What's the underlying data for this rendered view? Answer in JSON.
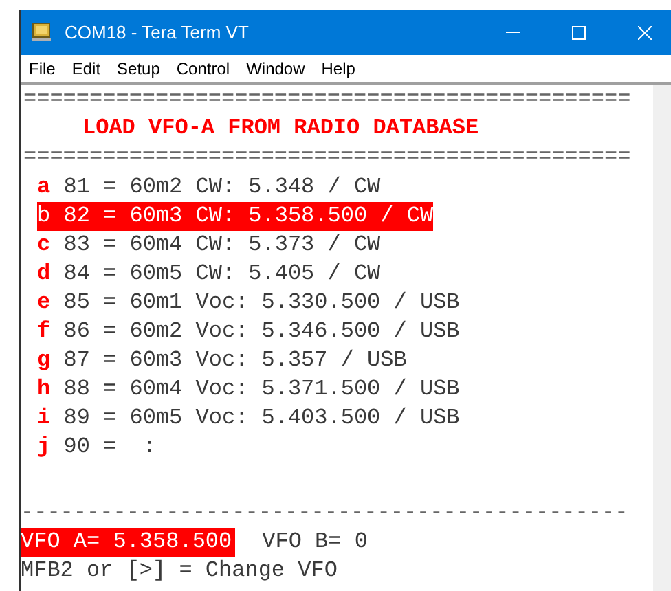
{
  "window": {
    "title": "COM18 - Tera Term VT"
  },
  "menu": [
    "File",
    "Edit",
    "Setup",
    "Control",
    "Window",
    "Help"
  ],
  "terminal": {
    "separator_top": "==============================================",
    "heading": "LOAD VFO-A FROM RADIO DATABASE",
    "separator_bottom": "==============================================",
    "entries": [
      {
        "key": "a",
        "text": "81 = 60m2 CW: 5.348 / CW",
        "selected": false
      },
      {
        "key": "b",
        "text": "82 = 60m3 CW: 5.358.500 / CW",
        "selected": true
      },
      {
        "key": "c",
        "text": "83 = 60m4 CW: 5.373 / CW",
        "selected": false
      },
      {
        "key": "d",
        "text": "84 = 60m5 CW: 5.405 / CW",
        "selected": false
      },
      {
        "key": "e",
        "text": "85 = 60m1 Voc: 5.330.500 / USB",
        "selected": false
      },
      {
        "key": "f",
        "text": "86 = 60m2 Voc: 5.346.500 / USB",
        "selected": false
      },
      {
        "key": "g",
        "text": "87 = 60m3 Voc: 5.357 / USB",
        "selected": false
      },
      {
        "key": "h",
        "text": "88 = 60m4 Voc: 5.371.500 / USB",
        "selected": false
      },
      {
        "key": "i",
        "text": "89 = 60m5 Voc: 5.403.500 / USB",
        "selected": false
      },
      {
        "key": "j",
        "text": "90 =  :",
        "selected": false
      }
    ],
    "divider": "----------------------------------------------",
    "vfo_a": "VFO A= 5.358.500",
    "vfo_b": "VFO B= 0",
    "hint": "MFB2 or [>] = Change VFO"
  }
}
